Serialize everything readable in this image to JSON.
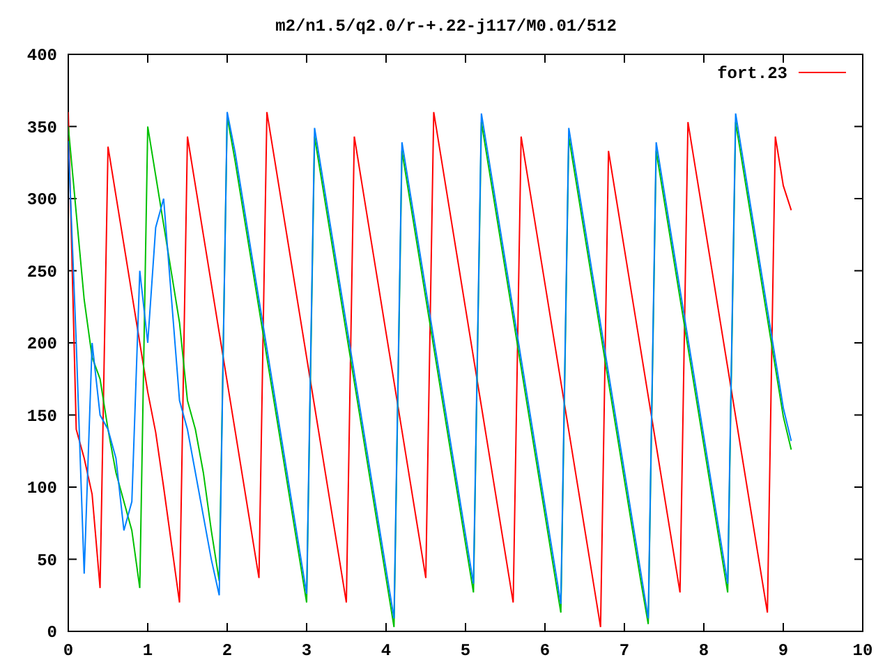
{
  "chart_data": {
    "type": "line",
    "title": "m2/n1.5/q2.0/r-+.22-j117/M0.01/512",
    "x": [
      0,
      0.1,
      0.2,
      0.3,
      0.4,
      0.5,
      0.6,
      0.7,
      0.8,
      0.9,
      1,
      1.1,
      1.2,
      1.3,
      1.4,
      1.5,
      1.6,
      1.7,
      1.8,
      1.9,
      2,
      2.1,
      2.2,
      2.3,
      2.4,
      2.5,
      2.6,
      2.7,
      2.8,
      2.9,
      3,
      3.1,
      3.2,
      3.3,
      3.4,
      3.5,
      3.6,
      3.7,
      3.8,
      3.9,
      4,
      4.1,
      4.2,
      4.3,
      4.4,
      4.5,
      4.6,
      4.7,
      4.8,
      4.9,
      5,
      5.1,
      5.2,
      5.3,
      5.4,
      5.5,
      5.6,
      5.7,
      5.8,
      5.9,
      6,
      6.1,
      6.2,
      6.3,
      6.4,
      6.5,
      6.6,
      6.7,
      6.8,
      6.9,
      7,
      7.1,
      7.2,
      7.3,
      7.4,
      7.5,
      7.6,
      7.7,
      7.8,
      7.9,
      8,
      8.1,
      8.2,
      8.3,
      8.4,
      8.5,
      8.6,
      8.7,
      8.8,
      8.9,
      9,
      9.1
    ],
    "series": [
      {
        "name": "fort.23",
        "color": "#ff0000",
        "values": [
          360,
          140,
          120,
          95,
          30,
          336,
          302,
          268,
          234,
          200,
          166,
          138,
          100,
          60,
          20,
          343,
          309,
          275,
          241,
          207,
          173,
          139,
          105,
          71,
          37,
          360,
          326,
          292,
          258,
          224,
          190,
          156,
          122,
          88,
          54,
          20,
          343,
          309,
          275,
          241,
          207,
          173,
          139,
          105,
          71,
          37,
          360,
          326,
          292,
          258,
          224,
          190,
          156,
          122,
          88,
          54,
          20,
          343,
          309,
          275,
          241,
          207,
          173,
          139,
          105,
          71,
          37,
          3,
          333,
          299,
          265,
          231,
          197,
          163,
          129,
          95,
          61,
          27,
          353,
          319,
          285,
          251,
          217,
          183,
          149,
          115,
          81,
          47,
          13,
          343,
          309,
          292
        ]
      },
      {
        "color": "#00c000",
        "values": [
          350,
          290,
          230,
          190,
          175,
          140,
          110,
          90,
          70,
          30,
          350,
          316,
          282,
          248,
          214,
          160,
          140,
          110,
          70,
          35,
          357,
          326,
          292,
          258,
          224,
          190,
          156,
          122,
          88,
          54,
          20,
          343,
          309,
          275,
          241,
          207,
          173,
          139,
          105,
          71,
          37,
          3,
          333,
          299,
          265,
          231,
          197,
          163,
          129,
          95,
          61,
          27,
          353,
          319,
          285,
          251,
          217,
          183,
          149,
          115,
          81,
          47,
          13,
          343,
          309,
          275,
          241,
          207,
          173,
          139,
          105,
          71,
          37,
          5,
          333,
          299,
          265,
          231,
          197,
          163,
          129,
          95,
          61,
          27,
          353,
          319,
          285,
          251,
          217,
          183,
          149,
          126
        ]
      },
      {
        "color": "#0080ff",
        "values": [
          340,
          200,
          40,
          200,
          150,
          140,
          120,
          70,
          90,
          250,
          200,
          280,
          300,
          230,
          160,
          140,
          110,
          80,
          50,
          25,
          360,
          332,
          298,
          264,
          230,
          196,
          162,
          128,
          94,
          60,
          26,
          349,
          315,
          281,
          247,
          213,
          179,
          145,
          111,
          77,
          43,
          9,
          339,
          305,
          271,
          237,
          203,
          169,
          135,
          101,
          67,
          33,
          359,
          325,
          291,
          257,
          223,
          189,
          155,
          121,
          87,
          53,
          19,
          349,
          315,
          281,
          247,
          213,
          179,
          145,
          111,
          77,
          43,
          9,
          339,
          305,
          271,
          237,
          203,
          169,
          135,
          101,
          67,
          33,
          359,
          325,
          291,
          257,
          223,
          189,
          155,
          132
        ]
      }
    ],
    "xlim": [
      0,
      10
    ],
    "ylim": [
      0,
      400
    ],
    "xticks": [
      0,
      1,
      2,
      3,
      4,
      5,
      6,
      7,
      8,
      9,
      10
    ],
    "yticks": [
      0,
      50,
      100,
      150,
      200,
      250,
      300,
      350,
      400
    ]
  }
}
